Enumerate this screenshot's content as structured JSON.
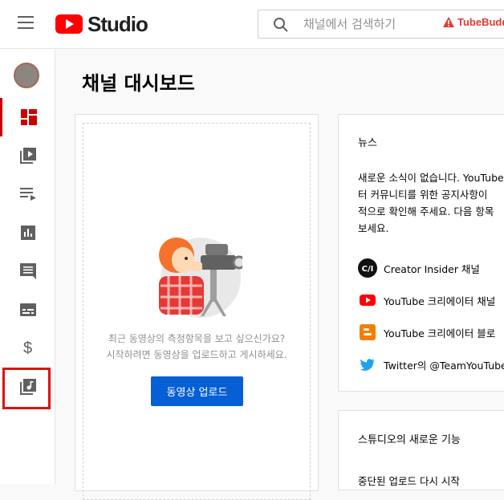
{
  "header": {
    "logo_text": "Studio",
    "search_placeholder": "채널에서 검색하기",
    "extension_label": "TubeBuddy"
  },
  "sidebar": {
    "items": [
      {
        "name": "dashboard",
        "active": true
      },
      {
        "name": "videos"
      },
      {
        "name": "playlists"
      },
      {
        "name": "analytics"
      },
      {
        "name": "comments"
      },
      {
        "name": "subtitles"
      },
      {
        "name": "monetization"
      },
      {
        "name": "audio-library",
        "highlighted": true
      }
    ]
  },
  "main": {
    "title": "채널 대시보드",
    "upload_card": {
      "prompt_line1": "최근 동영상의 측정항목을 보고 싶으신가요?",
      "prompt_line2": "시작하려면 동영상을 업로드하고 게시하세요.",
      "button_label": "동영상 업로드"
    },
    "news_card": {
      "title": "뉴스",
      "body": "새로운 소식이 없습니다. YouTube\n터 커뮤니티를 위한 공지사항이\n적으로 확인해 주세요. 다음 항목\n보세요.",
      "links": [
        {
          "label": "Creator Insider 채널",
          "icon": "creator-insider-icon"
        },
        {
          "label": "YouTube 크리에이터 채널",
          "icon": "youtube-icon"
        },
        {
          "label": "YouTube 크리에이터 블로",
          "icon": "blogger-icon"
        },
        {
          "label": "Twitter의 @TeamYouTube",
          "icon": "twitter-icon"
        }
      ]
    },
    "studio_card": {
      "title": "스튜디오의 새로운 기능",
      "item": "중단된 업로드 다시 시작"
    }
  },
  "colors": {
    "accent_red": "#ff0000",
    "upload_blue": "#065fd4",
    "highlight_box": "#e01010",
    "active_nav": "#cc0000"
  }
}
